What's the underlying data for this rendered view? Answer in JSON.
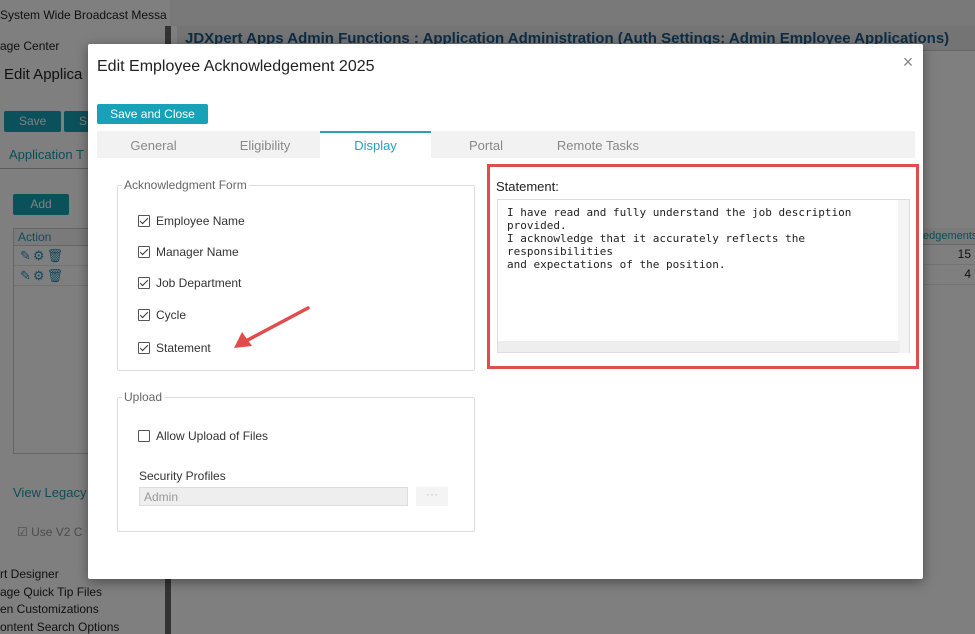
{
  "background": {
    "left_menu_top": [
      "System Wide Broadcast Messa",
      "age Center"
    ],
    "edit_title": "Edit Applica",
    "save_label": "Save",
    "save2_label": "S",
    "app_tab_label": "Application T",
    "add_label": "Add",
    "table_header": "Action",
    "legacy_link": "View Legacy",
    "use_v2_label": "Use V2 C",
    "bottom_menu": [
      "rt Designer",
      "age Quick Tip Files",
      "en Customizations",
      "ontent Search Options"
    ],
    "main_title": "JDXpert Apps Admin Functions : Application Administration (Auth Settings: Admin  Employee  Applications)",
    "right_table_header": "edgements",
    "right_values": [
      "15",
      "4"
    ]
  },
  "modal": {
    "title": "Edit Employee Acknowledgement 2025",
    "close_glyph": "×",
    "save_close_label": "Save and Close",
    "tabs": [
      {
        "label": "General",
        "active": false
      },
      {
        "label": "Eligibility",
        "active": false
      },
      {
        "label": "Display",
        "active": true
      },
      {
        "label": "Portal",
        "active": false
      },
      {
        "label": "Remote Tasks",
        "active": false
      }
    ],
    "ack_form": {
      "legend": "Acknowledgment Form",
      "items": [
        {
          "label": "Employee Name",
          "checked": true
        },
        {
          "label": "Manager Name",
          "checked": true
        },
        {
          "label": "Job Department",
          "checked": true
        },
        {
          "label": "Cycle",
          "checked": true
        },
        {
          "label": "Statement",
          "checked": true
        }
      ]
    },
    "upload": {
      "legend": "Upload",
      "allow_label": "Allow Upload of Files",
      "allow_checked": false,
      "security_label": "Security Profiles",
      "security_value": "Admin",
      "dots": "···"
    },
    "statement": {
      "label": "Statement:",
      "text": "I have read and fully understand the job description provided.\nI acknowledge that it accurately reflects the responsibilities\nand expectations of the position."
    }
  },
  "colors": {
    "accent": "#17a2b8",
    "highlight": "#e14c4c"
  }
}
